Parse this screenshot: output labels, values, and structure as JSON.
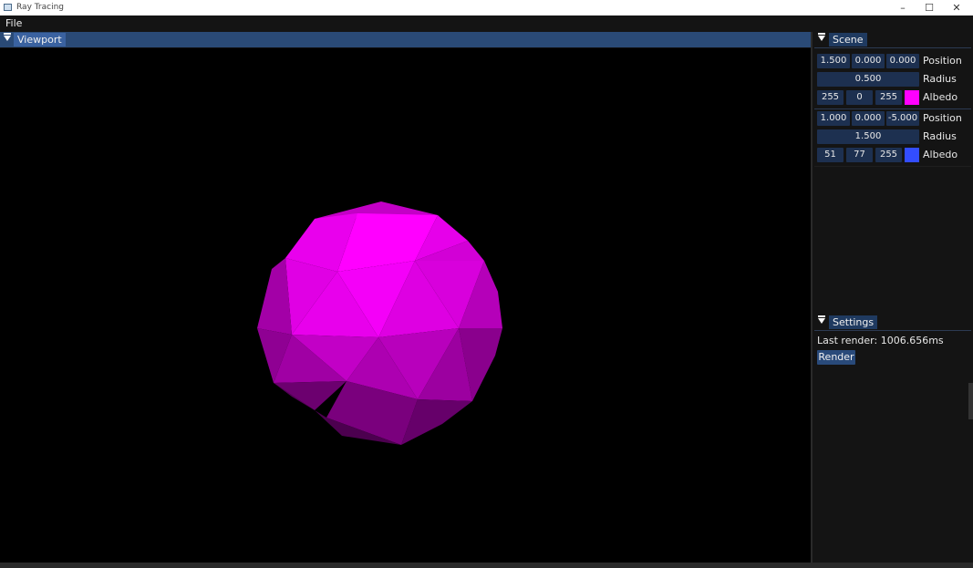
{
  "window": {
    "title": "Ray Tracing",
    "minimize": "–",
    "maximize": "☐",
    "close": "✕"
  },
  "menu": {
    "file": "File"
  },
  "viewport": {
    "tab_label": "Viewport"
  },
  "scene": {
    "tab_label": "Scene",
    "spheres": [
      {
        "position": [
          "1.500",
          "0.000",
          "0.000"
        ],
        "position_label": "Position",
        "radius": "0.500",
        "radius_label": "Radius",
        "albedo": [
          "255",
          "0",
          "255"
        ],
        "albedo_label": "Albedo",
        "albedo_color": "#ff00ff"
      },
      {
        "position": [
          "1.000",
          "0.000",
          "-5.000"
        ],
        "position_label": "Position",
        "radius": "1.500",
        "radius_label": "Radius",
        "albedo": [
          "51",
          "77",
          "255"
        ],
        "albedo_label": "Albedo",
        "albedo_color": "#334dff"
      }
    ]
  },
  "settings": {
    "tab_label": "Settings",
    "last_render": "Last render: 1006.656ms",
    "render_button": "Render"
  },
  "colors": {
    "accent": "#294a7a",
    "field_bg": "#1d3050",
    "sphere": "#ff00ff"
  }
}
